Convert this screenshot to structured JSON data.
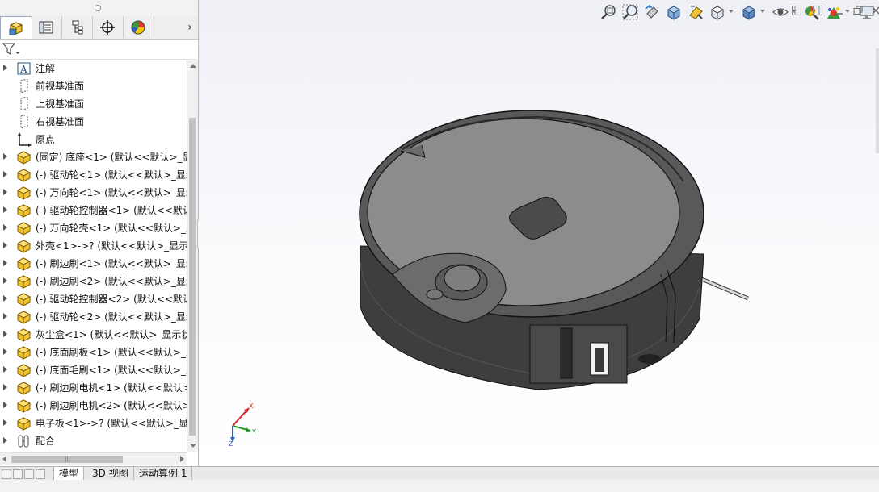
{
  "panel_tabs": [
    {
      "name": "featuremanager-tab-icon",
      "active": true
    },
    {
      "name": "propertymanager-tab-icon",
      "active": false
    },
    {
      "name": "configurationmanager-tab-icon",
      "active": false
    },
    {
      "name": "dimxpert-tab-icon",
      "active": false
    },
    {
      "name": "display-manager-tab-icon",
      "active": false
    }
  ],
  "tree": [
    {
      "icon": "annotations-icon",
      "label": "注解",
      "arrow": true
    },
    {
      "icon": "plane-icon",
      "label": "前视基准面",
      "arrow": false
    },
    {
      "icon": "plane-icon",
      "label": "上视基准面",
      "arrow": false
    },
    {
      "icon": "plane-icon",
      "label": "右视基准面",
      "arrow": false
    },
    {
      "icon": "origin-icon",
      "label": "原点",
      "arrow": false
    },
    {
      "icon": "part-icon",
      "label": "(固定) 底座<1> (默认<<默认>_显",
      "arrow": true
    },
    {
      "icon": "part-icon",
      "label": "(-) 驱动轮<1> (默认<<默认>_显示",
      "arrow": true
    },
    {
      "icon": "part-icon",
      "label": "(-) 万向轮<1> (默认<<默认>_显示",
      "arrow": true
    },
    {
      "icon": "part-icon",
      "label": "(-) 驱动轮控制器<1> (默认<<默认",
      "arrow": true
    },
    {
      "icon": "part-icon",
      "label": "(-) 万向轮壳<1> (默认<<默认>_显",
      "arrow": true
    },
    {
      "icon": "part-icon",
      "label": "外壳<1>->? (默认<<默认>_显示状",
      "arrow": true
    },
    {
      "icon": "part-icon",
      "label": "(-) 刷边刷<1> (默认<<默认>_显示",
      "arrow": true
    },
    {
      "icon": "part-icon",
      "label": "(-) 刷边刷<2> (默认<<默认>_显示",
      "arrow": true
    },
    {
      "icon": "part-icon",
      "label": "(-) 驱动轮控制器<2> (默认<<默认",
      "arrow": true
    },
    {
      "icon": "part-icon",
      "label": "(-) 驱动轮<2> (默认<<默认>_显示",
      "arrow": true
    },
    {
      "icon": "part-icon",
      "label": "灰尘盒<1> (默认<<默认>_显示状",
      "arrow": true
    },
    {
      "icon": "part-icon",
      "label": "(-) 底面刷板<1> (默认<<默认>_显",
      "arrow": true
    },
    {
      "icon": "part-icon",
      "label": "(-) 底面毛刷<1> (默认<<默认>_显",
      "arrow": true
    },
    {
      "icon": "part-icon",
      "label": "(-) 刷边刷电机<1> (默认<<默认>_",
      "arrow": true
    },
    {
      "icon": "part-icon",
      "label": "(-) 刷边刷电机<2> (默认<<默认>_",
      "arrow": true
    },
    {
      "icon": "part-icon",
      "label": "电子板<1>->? (默认<<默认>_显示",
      "arrow": true
    },
    {
      "icon": "mates-icon",
      "label": "配合",
      "arrow": true
    }
  ],
  "heads_up_toolbar": [
    "zoom-to-fit-icon",
    "zoom-to-area-icon",
    "previous-view-icon",
    "section-view-icon",
    "dynamic-annotation-views-icon",
    "view-orientation-icon",
    "display-style-icon",
    "hide-show-items-icon",
    "edit-appearance-icon",
    "apply-scene-icon",
    "view-settings-icon"
  ],
  "bottom_tabs": {
    "model": "模型",
    "view3d": "3D 视图",
    "motion": "运动算例 1"
  },
  "triad": {
    "x": "X",
    "y": "Y",
    "z": "Z"
  },
  "colors": {
    "accent_yellow": "#f2c233",
    "part_gray": "#8c8c8c",
    "body_dark": "#3e3e3e"
  }
}
